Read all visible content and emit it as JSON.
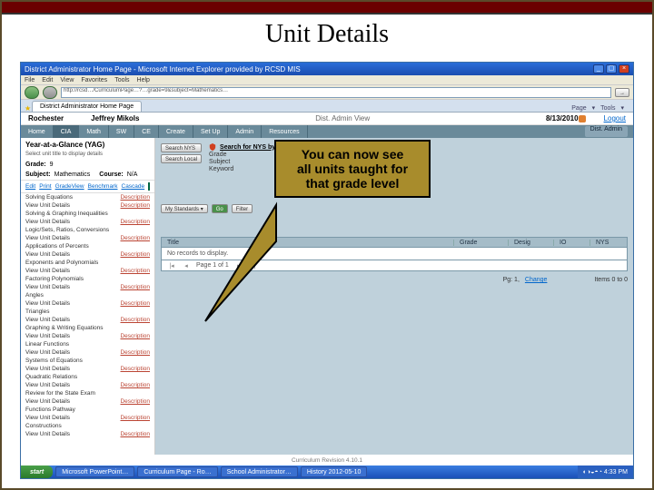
{
  "slide": {
    "title": "Unit Details"
  },
  "browser": {
    "title": "District Administrator Home Page - Microsoft Internet Explorer provided by RCSD MIS",
    "menus": [
      "File",
      "Edit",
      "View",
      "Favorites",
      "Tools",
      "Help"
    ],
    "address": "http://rcsd…/CurriculumPage…?…grade=9&subject=Mathematics…",
    "tab": "District Administrator Home Page",
    "right_tools": [
      "Page",
      "Tools"
    ]
  },
  "app": {
    "district": "Rochester",
    "user": "Jeffrey Mikols",
    "view": "Dist. Admin View",
    "date": "8/13/2010",
    "logout": "Logout",
    "admin_badge": "Dist. Admin",
    "nav": [
      "Home",
      "CIA",
      "Math",
      "SW",
      "CE",
      "Create",
      "Set Up",
      "Admin",
      "Resources"
    ]
  },
  "yag": {
    "heading": "Year-at-a-Glance (YAG)",
    "sub": "Select unit title to display details",
    "grade_label": "Grade:",
    "grade_value": "9",
    "subject_label": "Subject:",
    "subject_value": "Mathematics",
    "course_label": "Course:",
    "course_value": "N/A",
    "toolbar": {
      "edit": "Edit",
      "print": "Print",
      "gradeview": "GradeView",
      "benchmark": "Benchmark",
      "cascade": "Cascade"
    }
  },
  "units": [
    {
      "title": "Solving Equations",
      "link": "Description"
    },
    {
      "title": "View Unit Details",
      "link": "Description"
    },
    {
      "title": "Solving & Graphing Inequalities",
      "link": ""
    },
    {
      "title": "View Unit Details",
      "link": "Description"
    },
    {
      "title": "Logic/Sets, Ratios, Conversions",
      "link": ""
    },
    {
      "title": "View Unit Details",
      "link": "Description"
    },
    {
      "title": "Applications of Percents",
      "link": ""
    },
    {
      "title": "View Unit Details",
      "link": "Description"
    },
    {
      "title": "Exponents and Polynomials",
      "link": ""
    },
    {
      "title": "View Unit Details",
      "link": "Description"
    },
    {
      "title": "Factoring Polynomials",
      "link": ""
    },
    {
      "title": "View Unit Details",
      "link": "Description"
    },
    {
      "title": "Angles",
      "link": ""
    },
    {
      "title": "View Unit Details",
      "link": "Description"
    },
    {
      "title": "Triangles",
      "link": ""
    },
    {
      "title": "View Unit Details",
      "link": "Description"
    },
    {
      "title": "Graphing & Writing Equations",
      "link": ""
    },
    {
      "title": "View Unit Details",
      "link": "Description"
    },
    {
      "title": "Linear Functions",
      "link": ""
    },
    {
      "title": "View Unit Details",
      "link": "Description"
    },
    {
      "title": "Systems of Equations",
      "link": ""
    },
    {
      "title": "View Unit Details",
      "link": "Description"
    },
    {
      "title": "Quadratic Relations",
      "link": ""
    },
    {
      "title": "View Unit Details",
      "link": "Description"
    },
    {
      "title": "Review for the State Exam",
      "link": ""
    },
    {
      "title": "View Unit Details",
      "link": "Description"
    },
    {
      "title": "Functions Pathway",
      "link": ""
    },
    {
      "title": "View Unit Details",
      "link": "Description"
    },
    {
      "title": "Constructions",
      "link": ""
    },
    {
      "title": "View Unit Details",
      "link": "Description"
    }
  ],
  "search": {
    "buttons": [
      "Search NYS",
      "Search Local"
    ],
    "header": "Search for NYS by:",
    "fields": [
      "Grade",
      "Subject",
      "Keyword"
    ]
  },
  "table": {
    "toolbar_label": "My Standards",
    "filter": "Filter",
    "columns": [
      "Title",
      "Grade",
      "Desig",
      "IO",
      "NYS"
    ],
    "empty": "No records to display.",
    "pager_info": "Page 1 of 1"
  },
  "below": {
    "page_info": "Pg: 1,",
    "change": "Change",
    "total_right": "Items 0 to 0"
  },
  "footer": "Curriculum Revision 4.10.1",
  "callout": {
    "l1": "You can now see",
    "l2": "all units taught for",
    "l3": "that grade level"
  },
  "taskbar": {
    "start": "start",
    "buttons": [
      "Microsoft PowerPoint…",
      "Curriculum Page - Ro…",
      "School Administrator…",
      "History 2012-05-10"
    ],
    "time": "4:33 PM"
  }
}
